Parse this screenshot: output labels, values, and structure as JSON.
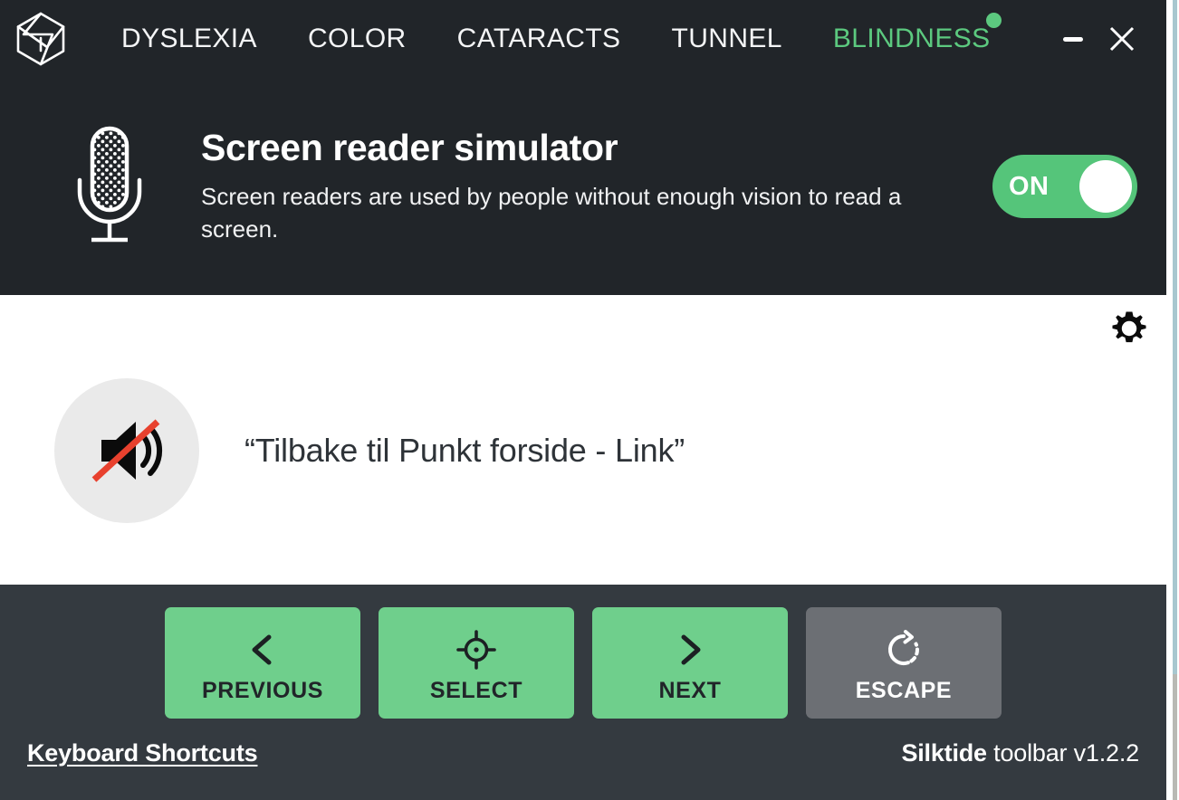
{
  "window": {
    "minimize_icon": "minimize-icon",
    "close_icon": "close-icon"
  },
  "navbar": {
    "logo_icon": "silktide-logo-icon",
    "items": [
      {
        "label": "DYSLEXIA",
        "active": false
      },
      {
        "label": "COLOR",
        "active": false
      },
      {
        "label": "CATARACTS",
        "active": false
      },
      {
        "label": "TUNNEL",
        "active": false
      },
      {
        "label": "BLINDNESS",
        "active": true,
        "badge": true
      }
    ]
  },
  "simulator": {
    "icon": "microphone-icon",
    "title": "Screen reader simulator",
    "description": "Screen readers are used by people without enough vision to read a screen.",
    "toggle": {
      "label": "ON",
      "state": "on"
    }
  },
  "content": {
    "settings_icon": "gear-icon",
    "mute_icon": "speaker-muted-icon",
    "announcement": "“Tilbake til Punkt forside - Link”"
  },
  "controls": {
    "buttons": [
      {
        "label": "PREVIOUS",
        "icon": "chevron-left-icon",
        "style": "primary"
      },
      {
        "label": "SELECT",
        "icon": "crosshair-icon",
        "style": "primary"
      },
      {
        "label": "NEXT",
        "icon": "chevron-right-icon",
        "style": "primary"
      },
      {
        "label": "ESCAPE",
        "icon": "rotate-escape-icon",
        "style": "secondary"
      }
    ]
  },
  "footer": {
    "shortcuts_label": "Keyboard Shortcuts",
    "brand_name": "Silktide",
    "brand_rest": " toolbar v1.2.2"
  },
  "colors": {
    "header_bg": "#212529",
    "bottom_bg": "#343a40",
    "accent_green": "#6fcf8c",
    "toggle_green": "#55c57a",
    "nav_active_green": "#5cc97f",
    "secondary_gray": "#6c6f74",
    "mute_slash_red": "#e8412e"
  }
}
